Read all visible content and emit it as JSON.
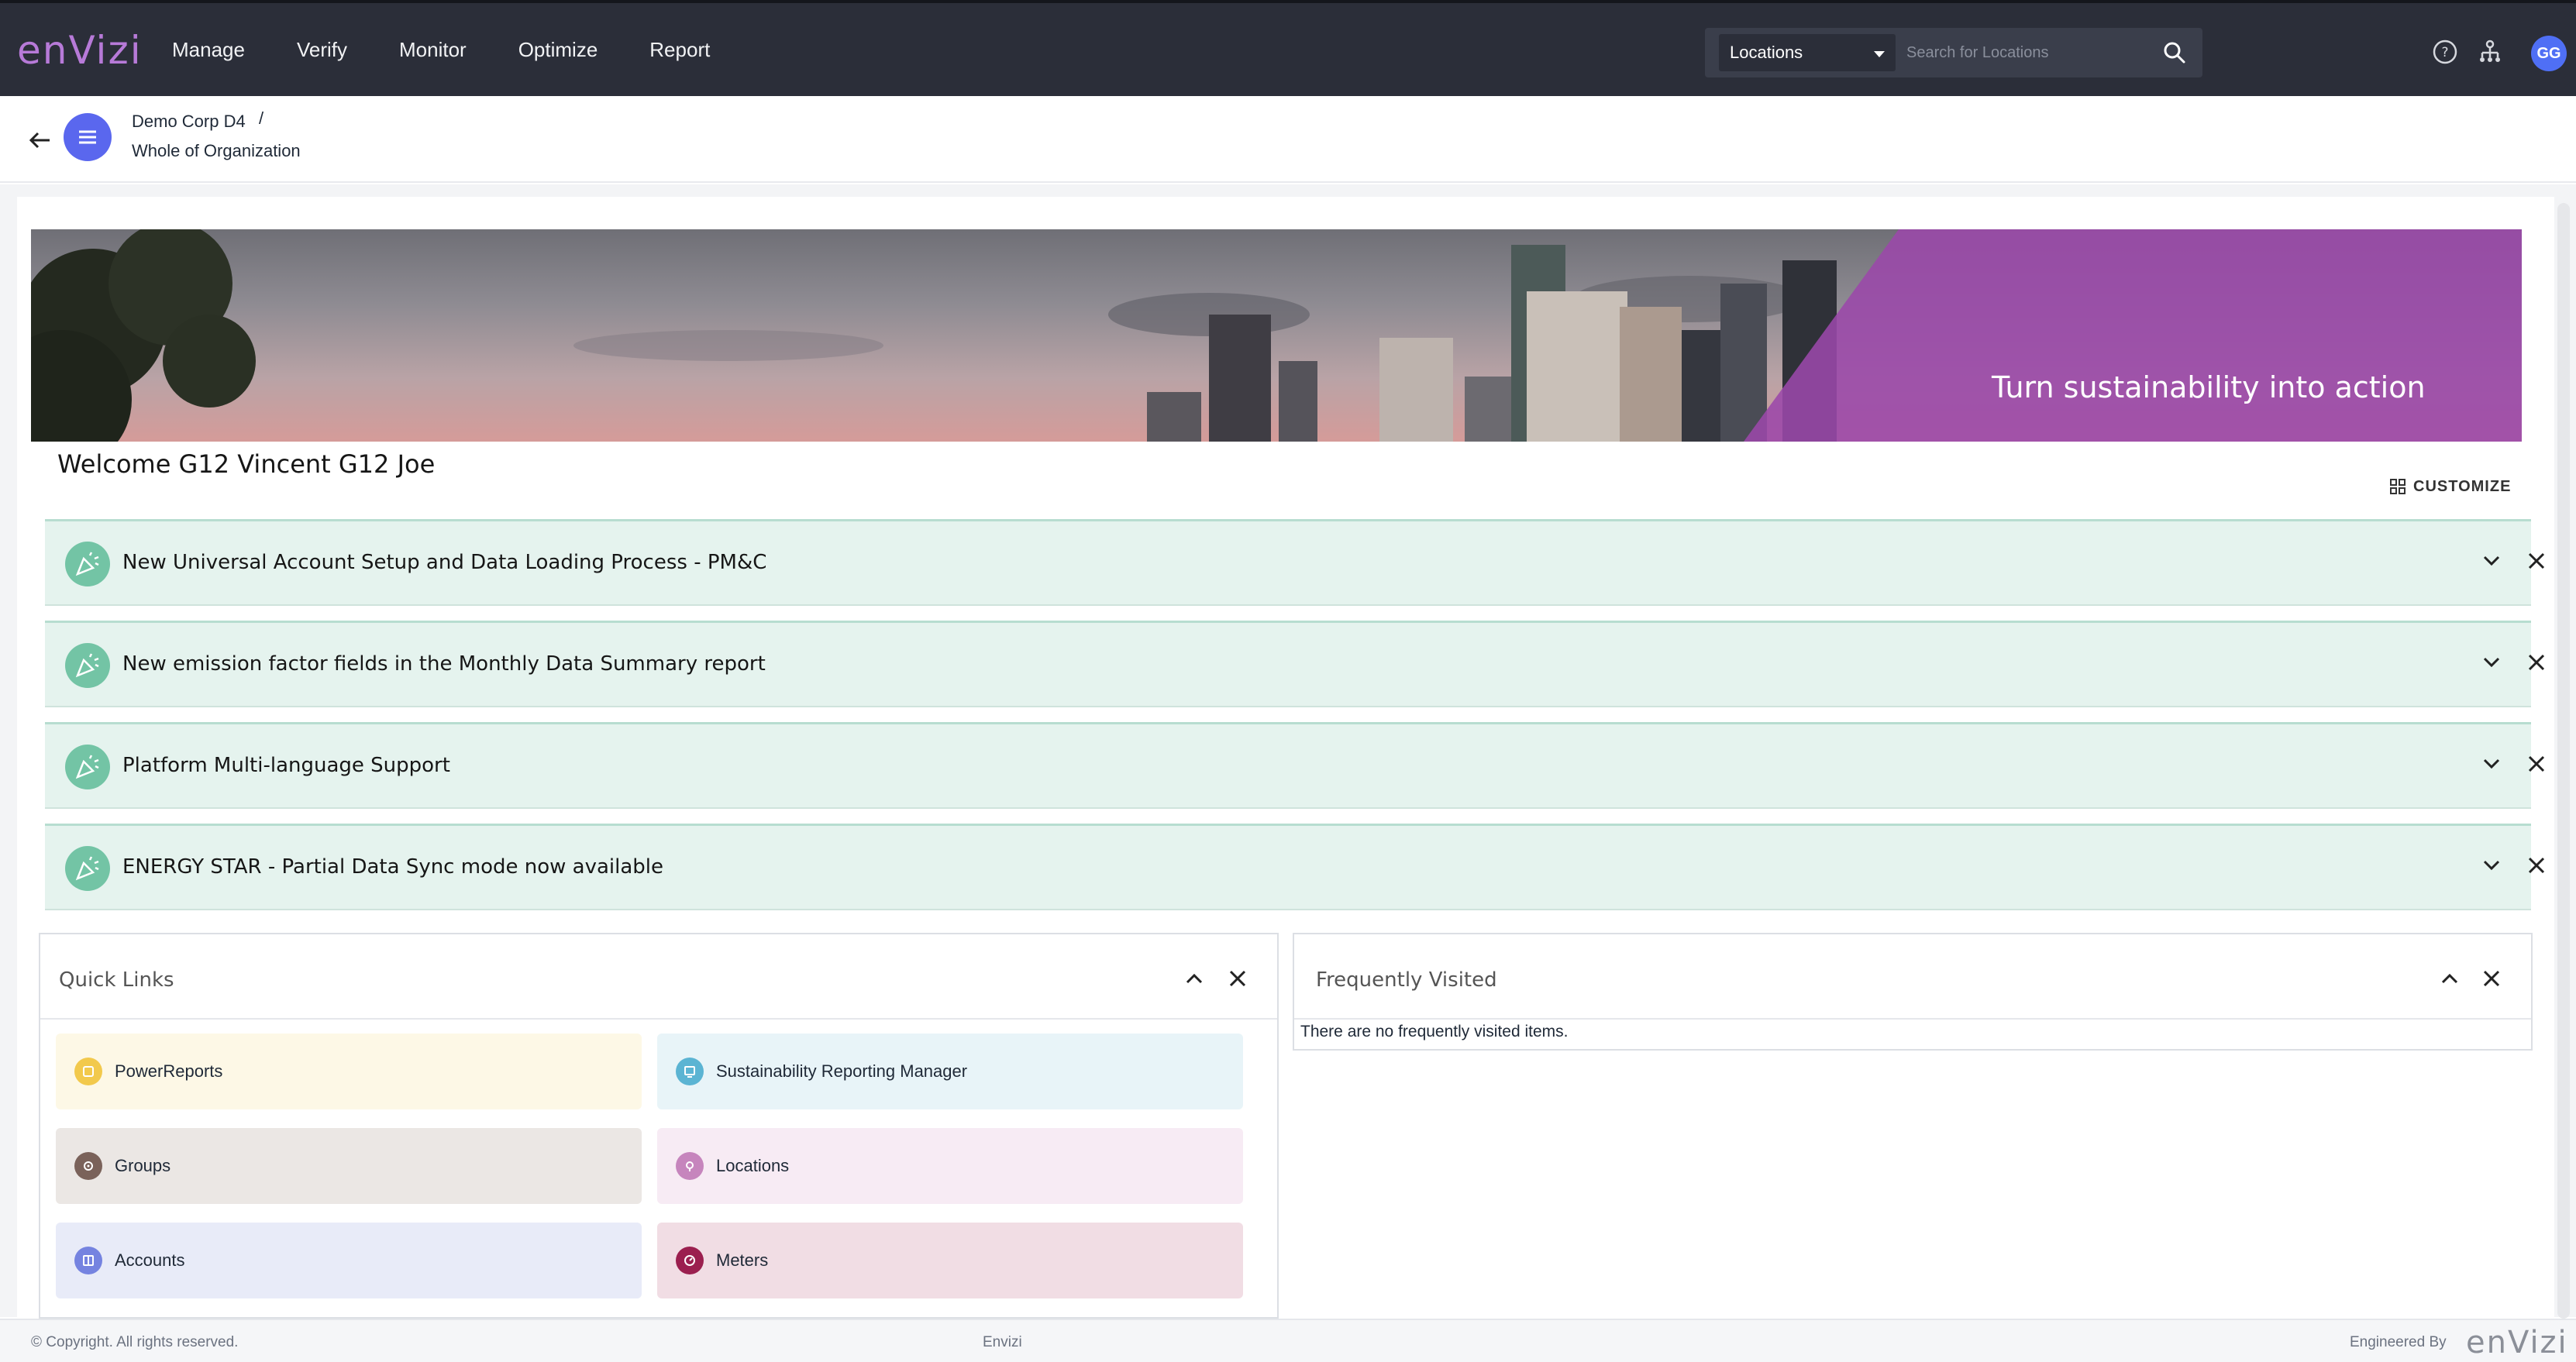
{
  "app": {
    "logo": "enVizi"
  },
  "nav": [
    "Manage",
    "Verify",
    "Monitor",
    "Optimize",
    "Report"
  ],
  "search": {
    "scope": "Locations",
    "placeholder": "Search for Locations"
  },
  "user": {
    "initials": "GG"
  },
  "breadcrumb": {
    "org": "Demo Corp D4",
    "separator": "/",
    "scope": "Whole of Organization"
  },
  "banner": {
    "tagline": "Turn sustainability into action"
  },
  "welcome": "Welcome G12 Vincent G12 Joe",
  "customize_label": "CUSTOMIZE",
  "announcements": [
    {
      "title": "New Universal Account Setup and Data Loading Process - PM&C"
    },
    {
      "title": "New emission factor fields in the Monthly Data Summary report"
    },
    {
      "title": "Platform Multi-language Support"
    },
    {
      "title": "ENERGY STAR - Partial Data Sync mode now available"
    }
  ],
  "quick_links": {
    "title": "Quick Links",
    "items": [
      {
        "label": "PowerReports",
        "icon": "power-reports-icon",
        "bg": "#fdf8e6",
        "icon_color": "#f2c94c"
      },
      {
        "label": "Sustainability Reporting Manager",
        "icon": "reporting-manager-icon",
        "bg": "#e8f4f8",
        "icon_color": "#5bb4d3"
      },
      {
        "label": "Groups",
        "icon": "groups-icon",
        "bg": "#ebe7e4",
        "icon_color": "#7a625a"
      },
      {
        "label": "Locations",
        "icon": "location-pin-icon",
        "bg": "#f7ebf4",
        "icon_color": "#c685bd"
      },
      {
        "label": "Accounts",
        "icon": "accounts-icon",
        "bg": "#e8ebf8",
        "icon_color": "#7583e0"
      },
      {
        "label": "Meters",
        "icon": "meter-gauge-icon",
        "bg": "#f1dde4",
        "icon_color": "#9b1f4f"
      }
    ]
  },
  "frequently_visited": {
    "title": "Frequently Visited",
    "empty_message": "There are no frequently visited items."
  },
  "footer": {
    "copyright": "© Copyright. All rights reserved.",
    "center": "Envizi",
    "engineered_by": "Engineered By",
    "logo": "enVizi"
  },
  "colors": {
    "topbar": "#2b2e39",
    "accent": "#5a67ee",
    "brand": "#b77ad8",
    "banner_overlay": "#9b48aa",
    "announcement_bg": "#e5f3ee"
  }
}
